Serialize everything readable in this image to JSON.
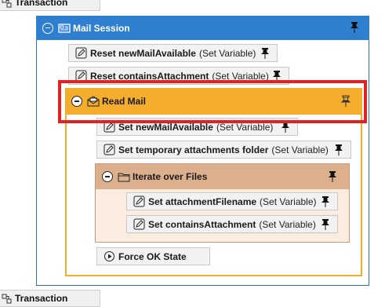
{
  "transaction_top": {
    "label": "Transaction"
  },
  "transaction_bottom": {
    "label": "Transaction"
  },
  "mail_session": {
    "label": "Mail Session",
    "actions": [
      {
        "name": "Reset newMailAvailable",
        "type": "(Set Variable)"
      },
      {
        "name": "Reset containsAttachment",
        "type": "(Set Variable)"
      }
    ]
  },
  "read_mail": {
    "label": "Read Mail",
    "actions": [
      {
        "name": "Set newMailAvailable",
        "type": "(Set Variable)"
      },
      {
        "name": "Set temporary attachments folder",
        "type": "(Set Variable)"
      }
    ],
    "iterate": {
      "label": "Iterate over Files",
      "actions": [
        {
          "name": "Set attachmentFilename",
          "type": "(Set Variable)"
        },
        {
          "name": "Set containsAttachment",
          "type": "(Set Variable)"
        }
      ]
    },
    "force_ok": {
      "label": "Force OK State"
    }
  },
  "colors": {
    "session_header": "#2f7fd0",
    "read_mail_header": "#f5ad2e",
    "iterate_header": "#dcb08c",
    "highlight": "#e02224"
  },
  "icons": {
    "transaction": "transaction-icon",
    "collapse": "collapse-icon",
    "session": "mail-session-icon",
    "pin": "pin-icon",
    "edit": "edit-pencil-icon",
    "read_mail": "read-mail-icon",
    "folder": "folder-icon",
    "play": "play-circle-icon"
  }
}
